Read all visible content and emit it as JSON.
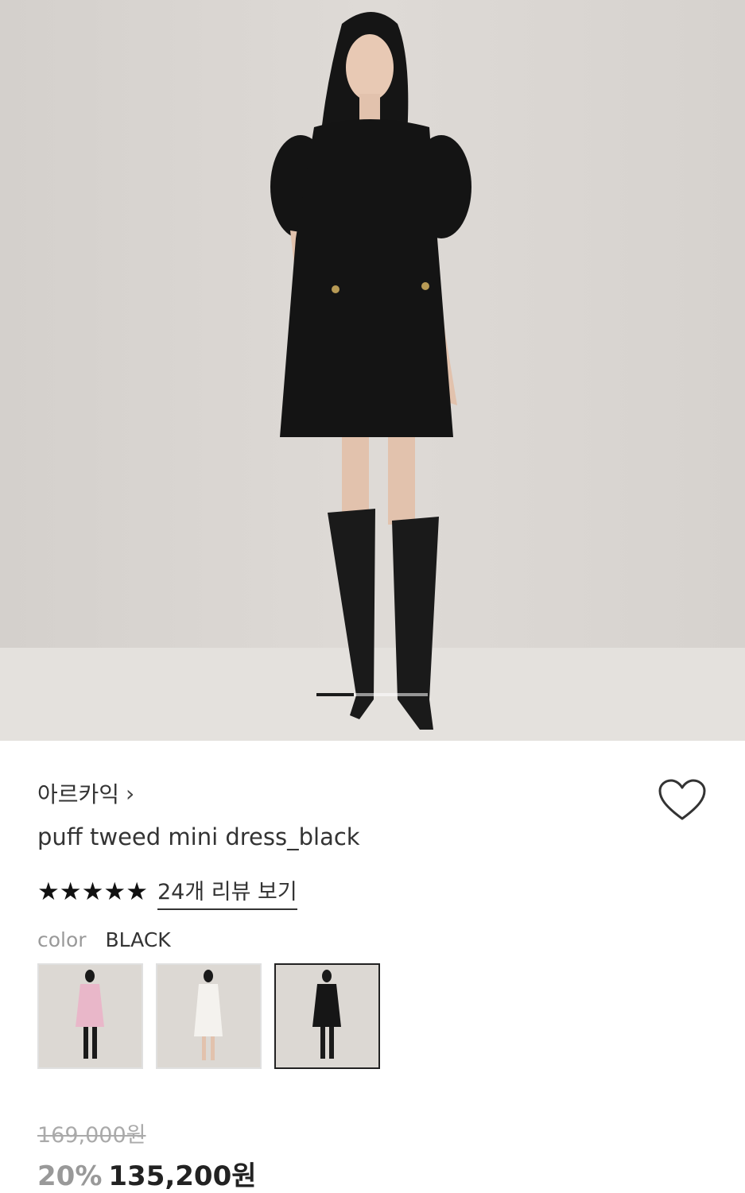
{
  "product": {
    "brand": "아르카익",
    "brand_chevron": "›",
    "title": "puff tweed mini dress_black",
    "rating_stars": [
      "★",
      "★",
      "★",
      "★",
      "★"
    ],
    "review_link": "24개 리뷰 보기",
    "color_label": "color",
    "color_value": "BLACK",
    "swatches": [
      {
        "color_name": "pink",
        "dress_color": "#e9b7c9",
        "selected": false
      },
      {
        "color_name": "white",
        "dress_color": "#f4f2ee",
        "selected": false
      },
      {
        "color_name": "black",
        "dress_color": "#161616",
        "selected": true
      }
    ],
    "original_price": "169,000원",
    "discount": "20%",
    "final_price": "135,200원"
  },
  "gallery": {
    "active_index": 1,
    "count": 3
  },
  "colors": {
    "backdrop": "#d9d5d1",
    "floor": "#e3e0dc",
    "dress": "#141414"
  }
}
